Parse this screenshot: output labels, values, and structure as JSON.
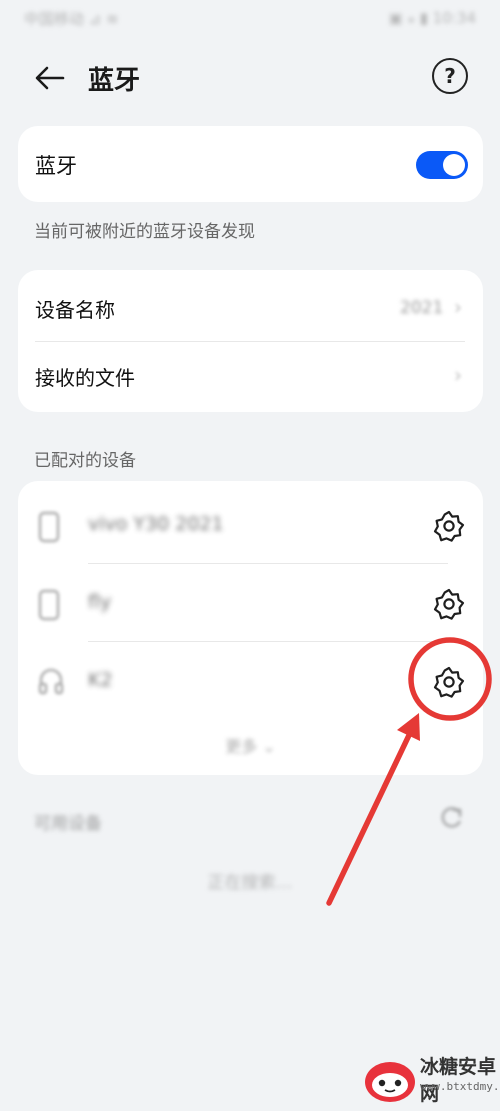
{
  "status_bar": {
    "carrier": "中国移动 ⊿ ≋",
    "right": "▣ ⁎ ▮ 10:34"
  },
  "header": {
    "title": "蓝牙",
    "help_glyph": "?"
  },
  "bluetooth": {
    "label": "蓝牙",
    "enabled": true,
    "accent_color": "#0a59f7"
  },
  "discover_caption": "当前可被附近的蓝牙设备发现",
  "info": {
    "device_name_label": "设备名称",
    "device_name_value": "2021",
    "received_files_label": "接收的文件",
    "chevron": "›"
  },
  "paired": {
    "caption": "已配对的设备",
    "devices": [
      {
        "name": "vivo Y30 2021",
        "icon": "phone-icon"
      },
      {
        "name": "fly",
        "icon": "phone-icon"
      },
      {
        "name": "K2",
        "icon": "headphones-icon"
      }
    ],
    "more_label": "更多 ⌄"
  },
  "available": {
    "title": "可用设备",
    "searching": "正在搜索…"
  },
  "annotation": {
    "color": "#e53935",
    "target": "gear-icon"
  },
  "watermark": {
    "name": "冰糖安卓网",
    "url": "www.btxtdmy.com"
  }
}
